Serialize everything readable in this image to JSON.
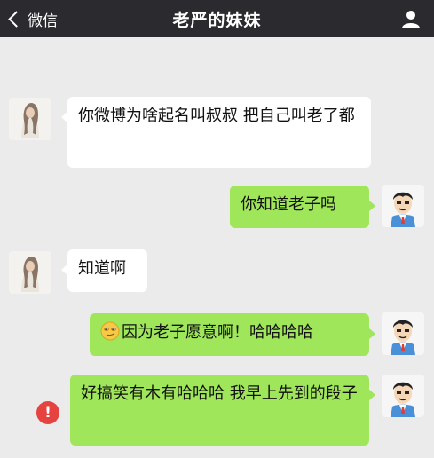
{
  "header": {
    "back_label": "微信",
    "title": "老严的妹妹"
  },
  "messages": [
    {
      "side": "left",
      "sender": "girl",
      "text": "你微博为啥起名叫叔叔 把自己叫老了都"
    },
    {
      "side": "right",
      "sender": "me",
      "text": "你知道老子吗"
    },
    {
      "side": "left",
      "sender": "girl",
      "text": "知道啊"
    },
    {
      "side": "right",
      "sender": "me",
      "emoji": "smirk-emoji",
      "text": "因为老子愿意啊！哈哈哈哈"
    },
    {
      "side": "right",
      "sender": "me",
      "status": "send-failed",
      "text": "好搞笑有木有哈哈哈 我早上先到的段子"
    }
  ],
  "icons": {
    "back": "chevron-left-icon",
    "profile": "person-icon",
    "error": "exclamation-icon"
  },
  "colors": {
    "topbar": "#2b2b2f",
    "background": "#ebebeb",
    "incoming_bubble": "#ffffff",
    "outgoing_bubble": "#9fe65a",
    "error": "#e64340"
  },
  "error_mark": "!"
}
